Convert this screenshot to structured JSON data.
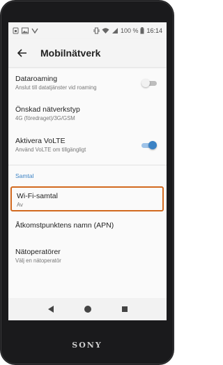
{
  "status_bar": {
    "battery_percent": "100 %",
    "time": "16:14",
    "left_icons": [
      "sim-card-icon",
      "image-icon",
      "signal-arrow-icon"
    ],
    "right_icons": [
      "vibrate-icon",
      "wifi-icon",
      "signal-icon",
      "battery-icon"
    ]
  },
  "app_bar": {
    "title": "Mobilnätverk",
    "back_icon": "arrow-back-icon"
  },
  "settings": [
    {
      "title": "Dataroaming",
      "subtitle": "Anslut till datatjänster vid roaming",
      "toggle": false
    },
    {
      "title": "Önskad nätverkstyp",
      "subtitle": "4G (föredraget)/3G/GSM"
    },
    {
      "title": "Aktivera VoLTE",
      "subtitle": "Använd VoLTE om tillgängligt",
      "toggle": true
    }
  ],
  "section": {
    "header": "Samtal"
  },
  "call_settings": [
    {
      "title": "Wi-Fi-samtal",
      "subtitle": "Av",
      "highlighted": true
    },
    {
      "title": "Åtkomstpunktens namn (APN)"
    },
    {
      "title": "Nätoperatörer",
      "subtitle": "Välj en nätoperatör"
    }
  ],
  "nav_bar": {
    "icons": [
      "back-triangle-icon",
      "home-circle-icon",
      "recents-square-icon"
    ]
  },
  "device": {
    "brand": "SONY"
  },
  "colors": {
    "accent": "#3b82c4",
    "toggle_on": "#3b82c4",
    "highlight_border": "#d2691e"
  }
}
